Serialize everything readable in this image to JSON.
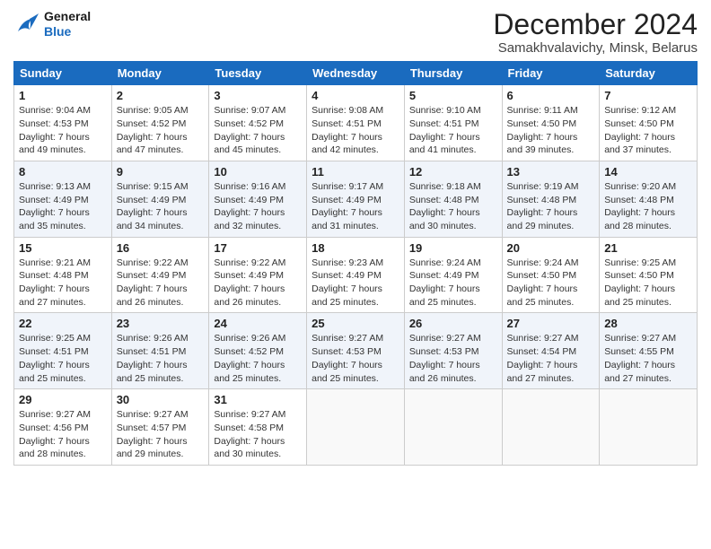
{
  "header": {
    "logo_general": "General",
    "logo_blue": "Blue",
    "month_title": "December 2024",
    "subtitle": "Samakhvalavichy, Minsk, Belarus"
  },
  "days_of_week": [
    "Sunday",
    "Monday",
    "Tuesday",
    "Wednesday",
    "Thursday",
    "Friday",
    "Saturday"
  ],
  "weeks": [
    [
      {
        "day": "1",
        "sunrise": "Sunrise: 9:04 AM",
        "sunset": "Sunset: 4:53 PM",
        "daylight": "Daylight: 7 hours and 49 minutes."
      },
      {
        "day": "2",
        "sunrise": "Sunrise: 9:05 AM",
        "sunset": "Sunset: 4:52 PM",
        "daylight": "Daylight: 7 hours and 47 minutes."
      },
      {
        "day": "3",
        "sunrise": "Sunrise: 9:07 AM",
        "sunset": "Sunset: 4:52 PM",
        "daylight": "Daylight: 7 hours and 45 minutes."
      },
      {
        "day": "4",
        "sunrise": "Sunrise: 9:08 AM",
        "sunset": "Sunset: 4:51 PM",
        "daylight": "Daylight: 7 hours and 42 minutes."
      },
      {
        "day": "5",
        "sunrise": "Sunrise: 9:10 AM",
        "sunset": "Sunset: 4:51 PM",
        "daylight": "Daylight: 7 hours and 41 minutes."
      },
      {
        "day": "6",
        "sunrise": "Sunrise: 9:11 AM",
        "sunset": "Sunset: 4:50 PM",
        "daylight": "Daylight: 7 hours and 39 minutes."
      },
      {
        "day": "7",
        "sunrise": "Sunrise: 9:12 AM",
        "sunset": "Sunset: 4:50 PM",
        "daylight": "Daylight: 7 hours and 37 minutes."
      }
    ],
    [
      {
        "day": "8",
        "sunrise": "Sunrise: 9:13 AM",
        "sunset": "Sunset: 4:49 PM",
        "daylight": "Daylight: 7 hours and 35 minutes."
      },
      {
        "day": "9",
        "sunrise": "Sunrise: 9:15 AM",
        "sunset": "Sunset: 4:49 PM",
        "daylight": "Daylight: 7 hours and 34 minutes."
      },
      {
        "day": "10",
        "sunrise": "Sunrise: 9:16 AM",
        "sunset": "Sunset: 4:49 PM",
        "daylight": "Daylight: 7 hours and 32 minutes."
      },
      {
        "day": "11",
        "sunrise": "Sunrise: 9:17 AM",
        "sunset": "Sunset: 4:49 PM",
        "daylight": "Daylight: 7 hours and 31 minutes."
      },
      {
        "day": "12",
        "sunrise": "Sunrise: 9:18 AM",
        "sunset": "Sunset: 4:48 PM",
        "daylight": "Daylight: 7 hours and 30 minutes."
      },
      {
        "day": "13",
        "sunrise": "Sunrise: 9:19 AM",
        "sunset": "Sunset: 4:48 PM",
        "daylight": "Daylight: 7 hours and 29 minutes."
      },
      {
        "day": "14",
        "sunrise": "Sunrise: 9:20 AM",
        "sunset": "Sunset: 4:48 PM",
        "daylight": "Daylight: 7 hours and 28 minutes."
      }
    ],
    [
      {
        "day": "15",
        "sunrise": "Sunrise: 9:21 AM",
        "sunset": "Sunset: 4:48 PM",
        "daylight": "Daylight: 7 hours and 27 minutes."
      },
      {
        "day": "16",
        "sunrise": "Sunrise: 9:22 AM",
        "sunset": "Sunset: 4:49 PM",
        "daylight": "Daylight: 7 hours and 26 minutes."
      },
      {
        "day": "17",
        "sunrise": "Sunrise: 9:22 AM",
        "sunset": "Sunset: 4:49 PM",
        "daylight": "Daylight: 7 hours and 26 minutes."
      },
      {
        "day": "18",
        "sunrise": "Sunrise: 9:23 AM",
        "sunset": "Sunset: 4:49 PM",
        "daylight": "Daylight: 7 hours and 25 minutes."
      },
      {
        "day": "19",
        "sunrise": "Sunrise: 9:24 AM",
        "sunset": "Sunset: 4:49 PM",
        "daylight": "Daylight: 7 hours and 25 minutes."
      },
      {
        "day": "20",
        "sunrise": "Sunrise: 9:24 AM",
        "sunset": "Sunset: 4:50 PM",
        "daylight": "Daylight: 7 hours and 25 minutes."
      },
      {
        "day": "21",
        "sunrise": "Sunrise: 9:25 AM",
        "sunset": "Sunset: 4:50 PM",
        "daylight": "Daylight: 7 hours and 25 minutes."
      }
    ],
    [
      {
        "day": "22",
        "sunrise": "Sunrise: 9:25 AM",
        "sunset": "Sunset: 4:51 PM",
        "daylight": "Daylight: 7 hours and 25 minutes."
      },
      {
        "day": "23",
        "sunrise": "Sunrise: 9:26 AM",
        "sunset": "Sunset: 4:51 PM",
        "daylight": "Daylight: 7 hours and 25 minutes."
      },
      {
        "day": "24",
        "sunrise": "Sunrise: 9:26 AM",
        "sunset": "Sunset: 4:52 PM",
        "daylight": "Daylight: 7 hours and 25 minutes."
      },
      {
        "day": "25",
        "sunrise": "Sunrise: 9:27 AM",
        "sunset": "Sunset: 4:53 PM",
        "daylight": "Daylight: 7 hours and 25 minutes."
      },
      {
        "day": "26",
        "sunrise": "Sunrise: 9:27 AM",
        "sunset": "Sunset: 4:53 PM",
        "daylight": "Daylight: 7 hours and 26 minutes."
      },
      {
        "day": "27",
        "sunrise": "Sunrise: 9:27 AM",
        "sunset": "Sunset: 4:54 PM",
        "daylight": "Daylight: 7 hours and 27 minutes."
      },
      {
        "day": "28",
        "sunrise": "Sunrise: 9:27 AM",
        "sunset": "Sunset: 4:55 PM",
        "daylight": "Daylight: 7 hours and 27 minutes."
      }
    ],
    [
      {
        "day": "29",
        "sunrise": "Sunrise: 9:27 AM",
        "sunset": "Sunset: 4:56 PM",
        "daylight": "Daylight: 7 hours and 28 minutes."
      },
      {
        "day": "30",
        "sunrise": "Sunrise: 9:27 AM",
        "sunset": "Sunset: 4:57 PM",
        "daylight": "Daylight: 7 hours and 29 minutes."
      },
      {
        "day": "31",
        "sunrise": "Sunrise: 9:27 AM",
        "sunset": "Sunset: 4:58 PM",
        "daylight": "Daylight: 7 hours and 30 minutes."
      },
      null,
      null,
      null,
      null
    ]
  ]
}
